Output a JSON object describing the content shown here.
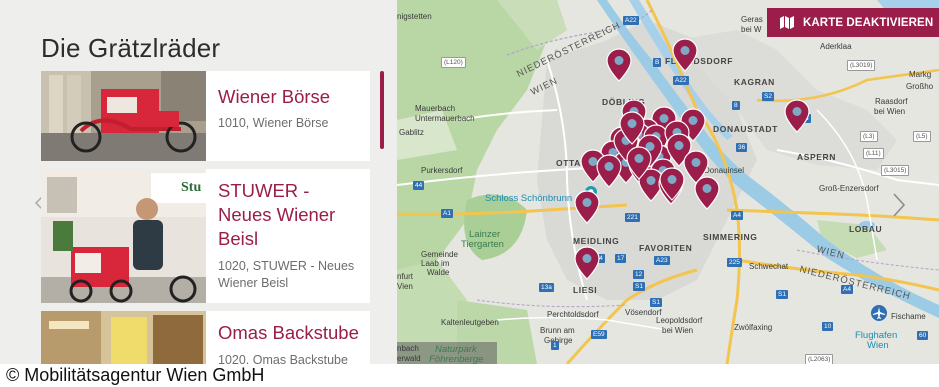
{
  "panel": {
    "title": "Die Grätzlräder",
    "cards": [
      {
        "title": "Wiener Börse",
        "subtitle": "1010, Wiener Börse"
      },
      {
        "title": "STUWER - Neues Wiener Beisl",
        "subtitle": "1020, STUWER - Neues Wiener Beisl"
      },
      {
        "title": "Omas Backstube",
        "subtitle": "1020, Omas Backstube"
      }
    ]
  },
  "map": {
    "toggle_label": "KARTE DEAKTIVIEREN",
    "labels": {
      "nigstetten": "nigstetten",
      "gerasdorf": "Geras",
      "gerasdorf2": "bei W",
      "floridsdorf": "FLORIDSDORF",
      "aderklaa": "Aderklaa",
      "markgraf": "Markg",
      "grossh": "Großho",
      "niederoesterreich_nw": "NIEDERÖSTERREICH",
      "wien_nw": "WIEN",
      "doebling": "DÖBLING",
      "kagran": "KAGRAN",
      "mauerbach": "Mauerbach",
      "untermauerbach": "Untermauerbach",
      "raasdorf": "Raasdorf",
      "raasdorf2": "bei Wien",
      "donaustadt": "DONAUSTADT",
      "gablitz": "Gablitz",
      "purkersdorf": "Purkersdorf",
      "ottakring": "OTTAKRING",
      "donauinsel": "Donauinsel",
      "aspern": "ASPERN",
      "gross_enzersdorf": "Groß-Enzersdorf",
      "schoenbrunn": "Schloss Schönbrunn",
      "lobau": "LOBAU",
      "lainzer": "Lainzer",
      "tiergarten": "Tiergarten",
      "meidling": "MEIDLING",
      "favoriten": "FAVORITEN",
      "simmering": "SIMMERING",
      "wien_e": "WIEN",
      "gemeinde": "Gemeinde",
      "laab": "Laab im",
      "walde": "Walde",
      "schwechat": "Schwechat",
      "niederoesterreich_se": "NIEDERÖSTERREICH",
      "liesing": "LIESI",
      "furt": "nfurt",
      "wien_w": "Vien",
      "perchtoldsdorf": "Perchtoldsdorf",
      "voesendorf": "Vösendorf",
      "kaltenleutgeben": "Kaltenleutgeben",
      "leopoldsdorf": "Leopoldsdorf",
      "leopoldsdorf2": "bei Wien",
      "zwoelfaxing": "Zwölfaxing",
      "brunn": "Brunn am",
      "gebirge": "Gebirge",
      "fischamend": "Fischame",
      "flughafen": "Flughafen",
      "flughafen2": "Wien",
      "naturpark": "Naturpark",
      "fohrenberge": "Föhrenberge",
      "erwald": "erwald",
      "mbach": "nbach"
    },
    "shields": {
      "a22_top": "A22",
      "l120": "(L120)",
      "l3019": "(L3019)",
      "b": "B",
      "s2": "S2",
      "a22_mid": "A22",
      "b8": "8",
      "a23": "A23",
      "l3": "(L3)",
      "l11": "(L11)",
      "l5": "(L5)",
      "l3015": "(L3015)",
      "b36": "36",
      "a1": "A1",
      "n44": "44",
      "n221": "221",
      "a4": "A4",
      "n224": "224",
      "n17": "17",
      "a23b": "A23",
      "n225": "225",
      "n13a": "13a",
      "s1": "S1",
      "n12": "12",
      "s1b": "S1",
      "s1c": "S1",
      "n10": "10",
      "a4b": "A4",
      "n60": "60",
      "l2063": "(L2063)",
      "e59": "E59",
      "n1": "1"
    },
    "colors": {
      "pin": "#9b1d4a",
      "accent": "#9b1d4a",
      "park": "#b7d8a8",
      "water": "#9ccbe6",
      "road": "#f3c44e"
    },
    "pin_count": 32
  },
  "caption": "© Mobilitätsagentur Wien GmbH"
}
